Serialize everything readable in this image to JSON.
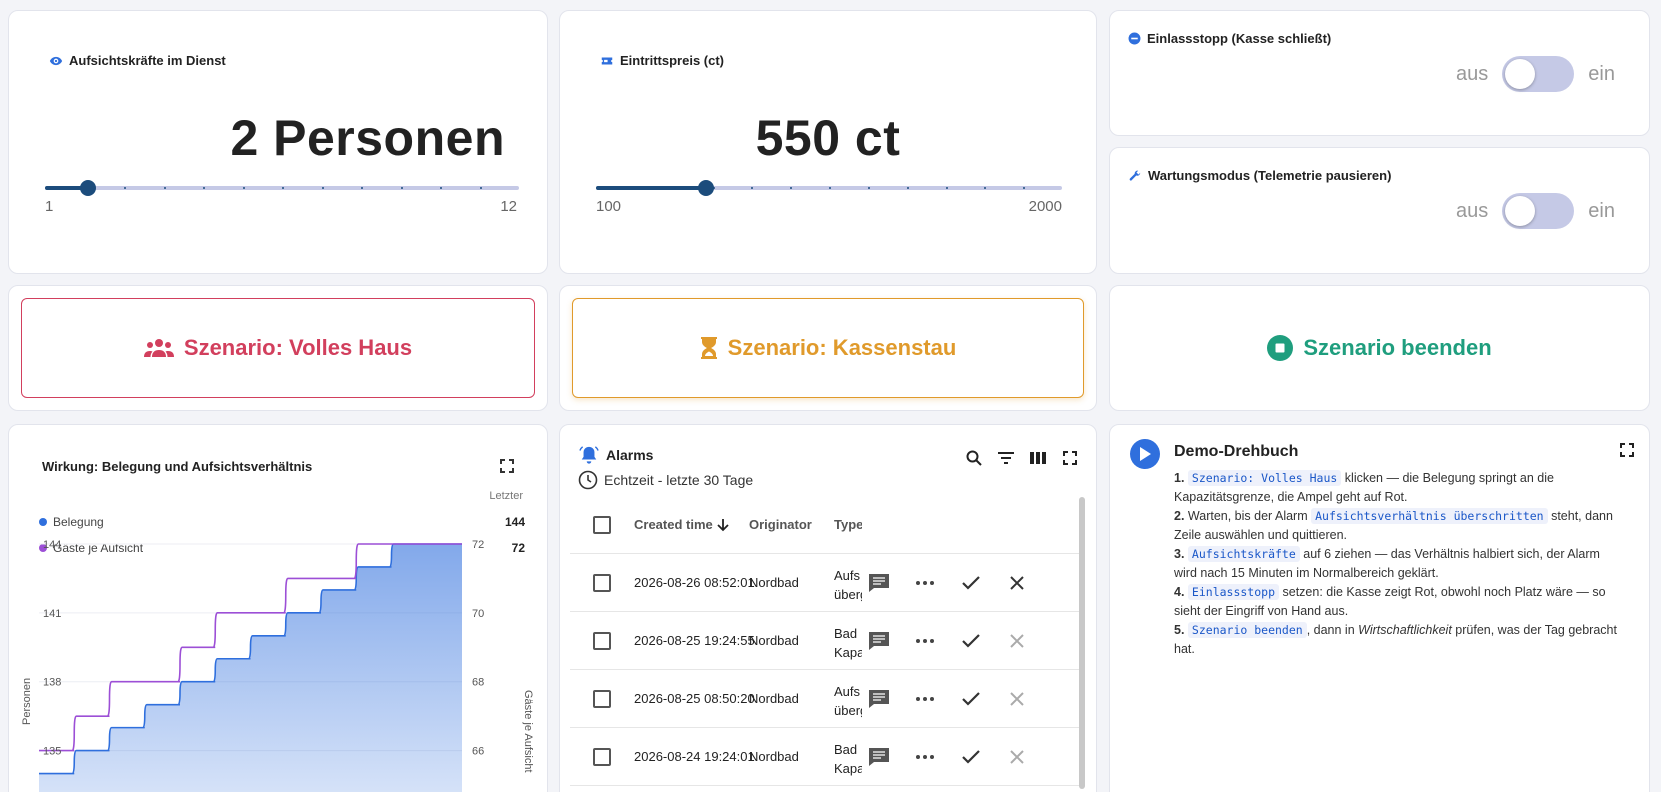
{
  "sliders": [
    {
      "title": "Aufsichtskräfte im Dienst",
      "value_text": "2 Personen",
      "min": "1",
      "max": "12",
      "value": 2,
      "min_num": 1,
      "max_num": 12,
      "icon": "eye-icon"
    },
    {
      "title": "Eintrittspreis (ct)",
      "value_text": "550 ct",
      "min": "100",
      "max": "2000",
      "value": 550,
      "min_num": 100,
      "max_num": 2000,
      "icon": "ticket-icon"
    }
  ],
  "toggles": [
    {
      "title": "Einlassstopp (Kasse schließt)",
      "off": "aus",
      "on": "ein",
      "state": false,
      "icon": "minus-circle-icon"
    },
    {
      "title": "Wartungsmodus (Telemetrie pausieren)",
      "off": "aus",
      "on": "ein",
      "state": false,
      "icon": "wrench-icon"
    }
  ],
  "scenarios": {
    "full": {
      "label": "Szenario: Volles Haus",
      "color": "#d23f5d",
      "icon": "group-icon"
    },
    "queue": {
      "label": "Szenario: Kassenstau",
      "color": "#e09a2b",
      "icon": "hourglass-icon"
    },
    "stop": {
      "label": "Szenario beenden",
      "color": "#1f9e7e",
      "icon": "stop-circle-icon"
    }
  },
  "chart": {
    "title": "Wirkung: Belegung und Aufsichtsverhältnis",
    "legend_header": "Letzter",
    "y_left_label": "Personen",
    "y_right_label": "Gäste je Aufsicht"
  },
  "chart_data": {
    "type": "line",
    "series": [
      {
        "name": "Belegung",
        "color": "#2f6fdd",
        "last": "144",
        "values": [
          134,
          135,
          136,
          137,
          138,
          139,
          140,
          141,
          142,
          143,
          144,
          144
        ]
      },
      {
        "name": "Gäste je Aufsicht",
        "color": "#9c4fd6",
        "last": "72",
        "values": [
          66,
          67,
          68,
          68,
          69,
          70,
          70,
          71,
          71,
          72,
          72,
          72
        ]
      }
    ],
    "y_left": {
      "ticks": [
        "144",
        "141",
        "138",
        "135"
      ],
      "range": [
        133.5,
        144
      ]
    },
    "y_right": {
      "ticks": [
        "72",
        "70",
        "68",
        "66"
      ],
      "range": [
        65,
        72
      ]
    }
  },
  "alarms": {
    "title": "Alarms",
    "subtitle": "Echtzeit - letzte 30 Tage",
    "columns": {
      "created": "Created time",
      "originator": "Originator",
      "type": "Type"
    },
    "rows": [
      {
        "time": "2026-08-26 08:52:01",
        "originator": "Nordbad",
        "type1": "Aufs",
        "type2": "überg",
        "clear_enabled": true
      },
      {
        "time": "2026-08-25 19:24:55",
        "originator": "Nordbad",
        "type1": "Bad",
        "type2": "Kapa",
        "clear_enabled": false
      },
      {
        "time": "2026-08-25 08:50:20",
        "originator": "Nordbad",
        "type1": "Aufs",
        "type2": "überg",
        "clear_enabled": false
      },
      {
        "time": "2026-08-24 19:24:01",
        "originator": "Nordbad",
        "type1": "Bad",
        "type2": "Kapa",
        "clear_enabled": false
      }
    ]
  },
  "guide": {
    "title": "Demo-Drehbuch",
    "steps": [
      {
        "num": "1.",
        "code": "Szenario: Volles Haus",
        "text1": " klicken — die Belegung springt an die Kapazitätsgrenze, die Ampel geht auf Rot."
      },
      {
        "num": "2.",
        "pre": " Warten, bis der Alarm ",
        "code": "Aufsichtsverhältnis überschritten",
        "text1": " steht, dann Zeile auswählen und quittieren."
      },
      {
        "num": "3.",
        "code": "Aufsichtskräfte",
        "text1": " auf 6 ziehen — das Verhältnis halbiert sich, der Alarm wird nach 15 Minuten im Normalbereich geklärt."
      },
      {
        "num": "4.",
        "code": "Einlassstopp",
        "text1": " setzen: die Kasse zeigt Rot, obwohl noch Platz wäre — so sieht der Eingriff von Hand aus."
      },
      {
        "num": "5.",
        "code": "Szenario beenden",
        "text1": ", dann in ",
        "em": "Wirtschaftlichkeit",
        "text2": " prüfen, was der Tag gebracht hat."
      }
    ]
  }
}
